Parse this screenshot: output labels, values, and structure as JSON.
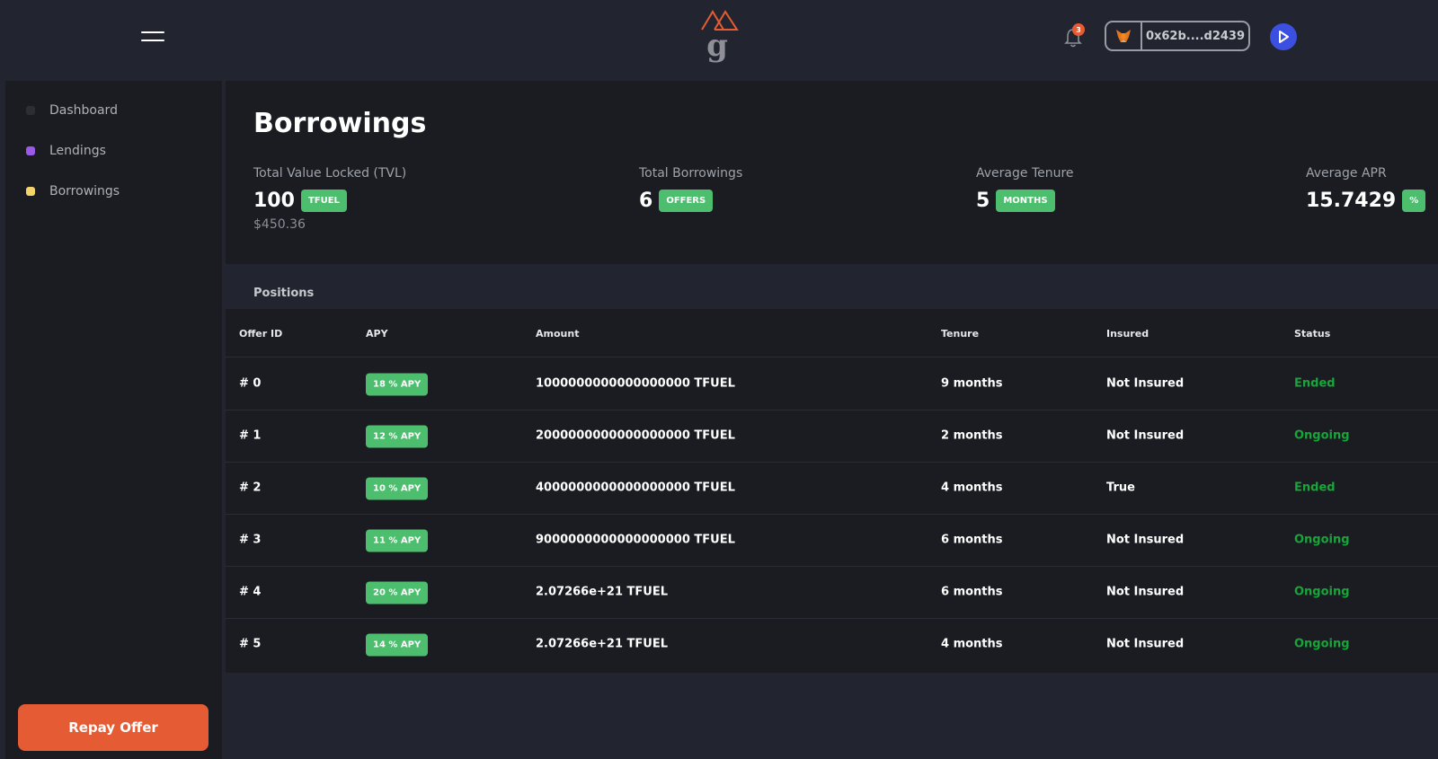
{
  "header": {
    "notification_count": "3",
    "wallet_address": "0x62b....d2439",
    "icons": {
      "menu": "hamburger-icon",
      "bell": "bell-icon",
      "wallet": "metamask-fox-icon",
      "avatar": "play-avatar-icon",
      "logo": "mountain-g-logo"
    },
    "colors": {
      "logo_peak": "#e55b33",
      "logo_letter": "#8f9097",
      "avatar_bg": "#3b4fe0"
    }
  },
  "sidebar": {
    "items": [
      {
        "label": "Dashboard",
        "dot_color": "#2c2e36"
      },
      {
        "label": "Lendings",
        "dot_color": "#9b59e6"
      },
      {
        "label": "Borrowings",
        "dot_color": "#f5d36b"
      }
    ],
    "repay_button": "Repay Offer"
  },
  "summary": {
    "title": "Borrowings",
    "stats": [
      {
        "label": "Total Value Locked (TVL)",
        "value": "100",
        "unit": "TFUEL",
        "sub": "$450.36"
      },
      {
        "label": "Total Borrowings",
        "value": "6",
        "unit": "OFFERS"
      },
      {
        "label": "Average Tenure",
        "value": "5",
        "unit": "MONTHS"
      },
      {
        "label": "Average APR",
        "value": "15.7429",
        "unit": "%"
      }
    ]
  },
  "positions": {
    "label": "Positions",
    "columns": [
      "Offer ID",
      "APY",
      "Amount",
      "Tenure",
      "Insured",
      "Status"
    ],
    "rows": [
      {
        "id": "# 0",
        "apy": "18 % APY",
        "amount": "1000000000000000000 TFUEL",
        "tenure": "9 months",
        "insured": "Not Insured",
        "status": "Ended"
      },
      {
        "id": "# 1",
        "apy": "12 % APY",
        "amount": "2000000000000000000 TFUEL",
        "tenure": "2 months",
        "insured": "Not Insured",
        "status": "Ongoing"
      },
      {
        "id": "# 2",
        "apy": "10 % APY",
        "amount": "4000000000000000000 TFUEL",
        "tenure": "4 months",
        "insured": "True",
        "status": "Ended"
      },
      {
        "id": "# 3",
        "apy": "11 % APY",
        "amount": "9000000000000000000 TFUEL",
        "tenure": "6 months",
        "insured": "Not Insured",
        "status": "Ongoing"
      },
      {
        "id": "# 4",
        "apy": "20 % APY",
        "amount": "2.07266e+21 TFUEL",
        "tenure": "6 months",
        "insured": "Not Insured",
        "status": "Ongoing"
      },
      {
        "id": "# 5",
        "apy": "14 % APY",
        "amount": "2.07266e+21 TFUEL",
        "tenure": "4 months",
        "insured": "Not Insured",
        "status": "Ongoing"
      }
    ],
    "colors": {
      "tag_bg": "#4dbd6e",
      "status_text": "#18a53a"
    }
  }
}
